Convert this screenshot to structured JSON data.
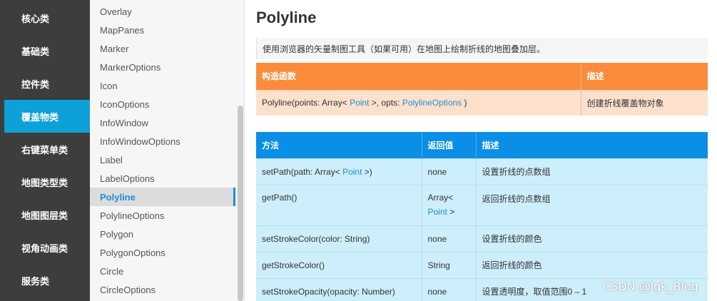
{
  "categories": [
    {
      "label": "核心类"
    },
    {
      "label": "基础类"
    },
    {
      "label": "控件类"
    },
    {
      "label": "覆盖物类",
      "active": true
    },
    {
      "label": "右键菜单类"
    },
    {
      "label": "地图类型类"
    },
    {
      "label": "地图图层类"
    },
    {
      "label": "视角动画类"
    },
    {
      "label": "服务类"
    }
  ],
  "classes": [
    "Overlay",
    "MapPanes",
    "Marker",
    "MarkerOptions",
    "Icon",
    "IconOptions",
    "InfoWindow",
    "InfoWindowOptions",
    "Label",
    "LabelOptions",
    "Polyline",
    "PolylineOptions",
    "Polygon",
    "PolygonOptions",
    "Circle",
    "CircleOptions"
  ],
  "active_class": "Polyline",
  "page": {
    "title": "Polyline",
    "description": "使用浏览器的矢量制图工具（如果可用）在地图上绘制折线的地图叠加层。"
  },
  "constructor_table": {
    "headers": [
      "构造函数",
      "描述"
    ],
    "row": {
      "sig_prefix": "Polyline(points: Array< ",
      "sig_link1": "Point",
      "sig_mid": " >, opts: ",
      "sig_link2": "PolylineOptions",
      "sig_suffix": " )",
      "desc": "创建折线覆盖物对象"
    }
  },
  "method_table": {
    "headers": [
      "方法",
      "返回值",
      "描述"
    ],
    "rows": [
      {
        "m_prefix": "setPath(path: Array< ",
        "m_link": "Point",
        "m_suffix": " >)",
        "ret": "none",
        "desc": "设置折线的点数组"
      },
      {
        "m_prefix": "getPath()",
        "ret_prefix": "Array<",
        "ret_link": "Point",
        "ret_suffix": " >",
        "desc": "返回折线的点数组"
      },
      {
        "m_prefix": "setStrokeColor(color: String)",
        "ret": "none",
        "desc": "设置折线的颜色"
      },
      {
        "m_prefix": "getStrokeColor()",
        "ret": "String",
        "desc": "返回折线的颜色"
      },
      {
        "m_prefix": "setStrokeOpacity(opacity: Number)",
        "ret": "none",
        "desc": "设置透明度，取值范围0 – 1"
      }
    ]
  },
  "watermark": "CSDN @lgk_Blog",
  "colors": {
    "category_bg": "#3d3d3d",
    "category_active": "#0ea0d8",
    "ctor_header": "#fb8c3b",
    "ctor_row": "#fde1cd",
    "method_header": "#0a8ee6",
    "method_row": "#cdeefb",
    "link": "#1d8fd0"
  }
}
